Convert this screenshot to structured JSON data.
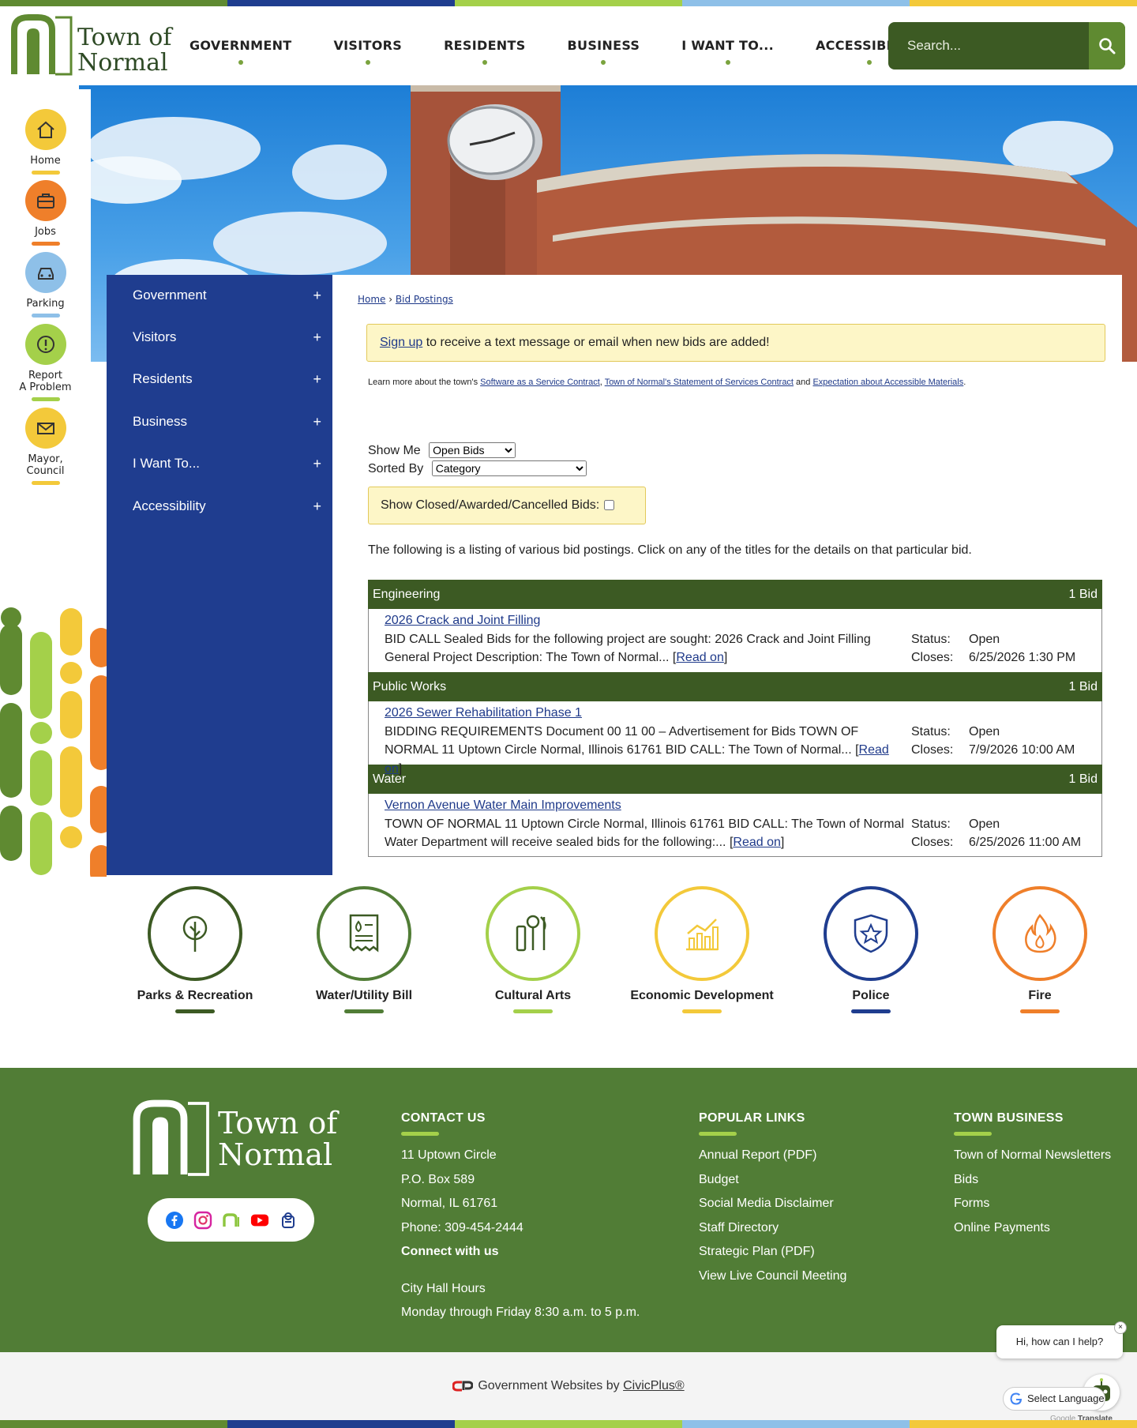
{
  "colors": {
    "stripe": [
      "#5f8a31",
      "#1f3d8f",
      "#a4d04a",
      "#8ec0e8",
      "#f3c93a"
    ],
    "primary_green": "#3c5a23",
    "footer_green": "#517d36",
    "nav_blue": "#1f3d8f"
  },
  "header": {
    "logo_line1": "Town of",
    "logo_line2": "Normal",
    "nav": [
      "GOVERNMENT",
      "VISITORS",
      "RESIDENTS",
      "BUSINESS",
      "I WANT TO...",
      "ACCESSIBILITY"
    ],
    "search_placeholder": "Search..."
  },
  "quick_links": [
    {
      "label": "Home",
      "icon": "home-icon",
      "color": "#f3c93a"
    },
    {
      "label": "Jobs",
      "icon": "briefcase-icon",
      "color": "#ef7f2a"
    },
    {
      "label": "Parking",
      "icon": "car-icon",
      "color": "#8ec0e8"
    },
    {
      "label": "Report",
      "label2": "A Problem",
      "icon": "alert-icon",
      "color": "#a4d04a"
    },
    {
      "label": "Mayor,",
      "label2": "Council",
      "icon": "mail-icon",
      "color": "#f3c93a"
    }
  ],
  "side_nav": [
    {
      "label": "Government"
    },
    {
      "label": "Visitors"
    },
    {
      "label": "Residents"
    },
    {
      "label": "Business"
    },
    {
      "label": "I Want To..."
    },
    {
      "label": "Accessibility"
    }
  ],
  "side_nav_expand": "+",
  "breadcrumb": {
    "home": "Home",
    "current": "Bid Postings",
    "sep": "›"
  },
  "signup": {
    "link": "Sign up",
    "text": " to receive a text message or email when new bids are added!"
  },
  "learn": {
    "prefix": "Learn more about the town's ",
    "link1": "Software as a Service Contract",
    "sep1": ", ",
    "link2": "Town of Normal's Statement of Services Contract",
    "and": " and ",
    "link3": "Expectation about Accessible Materials",
    "suffix": "."
  },
  "filters": {
    "show_me_label": "Show Me",
    "show_me_value": "Open Bids",
    "sorted_by_label": "Sorted By",
    "sorted_by_value": "Category",
    "closed_label": "Show Closed/Awarded/Cancelled Bids:"
  },
  "intro": "The following is a listing of various bid postings. Click on any of the titles for the details on that particular bid.",
  "bid_categories": [
    {
      "name": "Engineering",
      "count": "1 Bid",
      "bid": {
        "title": "2026 Crack and Joint Filling",
        "desc": "BID CALL Sealed Bids for the following project are sought: 2026 Crack and Joint Filling General Project Description: The Town of Normal... ",
        "read": "Read on",
        "status_label": "Status:",
        "status": "Open",
        "closes_label": "Closes:",
        "closes": "6/25/2026 1:30 PM"
      }
    },
    {
      "name": "Public Works",
      "count": "1 Bid",
      "bid": {
        "title": "2026 Sewer Rehabilitation Phase 1",
        "desc": "BIDDING REQUIREMENTS Document 00 11 00 – Advertisement for Bids TOWN OF NORMAL 11 Uptown Circle Normal, Illinois 61761 BID CALL: The Town of Normal... ",
        "read": "Read on",
        "status_label": "Status:",
        "status": "Open",
        "closes_label": "Closes:",
        "closes": "7/9/2026 10:00 AM"
      }
    },
    {
      "name": "Water",
      "count": "1 Bid",
      "bid": {
        "title": "Vernon Avenue Water Main Improvements",
        "desc": "TOWN OF NORMAL 11 Uptown Circle Normal, Illinois 61761 BID CALL: The Town of Normal Water Department will receive sealed bids for the following:... ",
        "read": "Read on",
        "status_label": "Status:",
        "status": "Open",
        "closes_label": "Closes:",
        "closes": "6/25/2026 11:00 AM"
      }
    }
  ],
  "features": [
    {
      "label": "Parks & Recreation",
      "icon": "tree-icon",
      "color": "#3c5a23"
    },
    {
      "label": "Water/Utility Bill",
      "icon": "water-bill-icon",
      "color": "#517d36"
    },
    {
      "label": "Cultural Arts",
      "icon": "arts-icon",
      "color": "#a4d04a"
    },
    {
      "label": "Economic Development",
      "icon": "growth-chart-icon",
      "color": "#f3c93a"
    },
    {
      "label": "Police",
      "icon": "badge-icon",
      "color": "#1f3d8f"
    },
    {
      "label": "Fire",
      "icon": "flame-icon",
      "color": "#ef7f2a"
    }
  ],
  "footer": {
    "logo_line1": "Town of",
    "logo_line2": "Normal",
    "contact": {
      "heading": "CONTACT US",
      "lines": [
        "11 Uptown Circle",
        "P.O. Box 589",
        "Normal, IL 61761",
        "Phone: 309-454-2444"
      ],
      "connect": "Connect with us",
      "hours_title": "City Hall Hours",
      "hours": "Monday through Friday 8:30 a.m. to 5 p.m."
    },
    "popular": {
      "heading": "POPULAR LINKS",
      "links": [
        "Annual Report (PDF)",
        "Budget",
        "Social Media Disclaimer",
        "Staff Directory",
        "Strategic Plan (PDF)",
        "View Live Council Meeting"
      ]
    },
    "business": {
      "heading": "TOWN BUSINESS",
      "links": [
        "Town of Normal Newsletters",
        "Bids",
        "Forms",
        "Online Payments"
      ]
    }
  },
  "copyright": {
    "text": "Government Websites by ",
    "link": "CivicPlus®"
  },
  "chat": {
    "text": "Hi, how can I help?",
    "close": "×"
  },
  "translate": {
    "text": "Select Language",
    "powered": "Google",
    "powered2": "Translate"
  }
}
